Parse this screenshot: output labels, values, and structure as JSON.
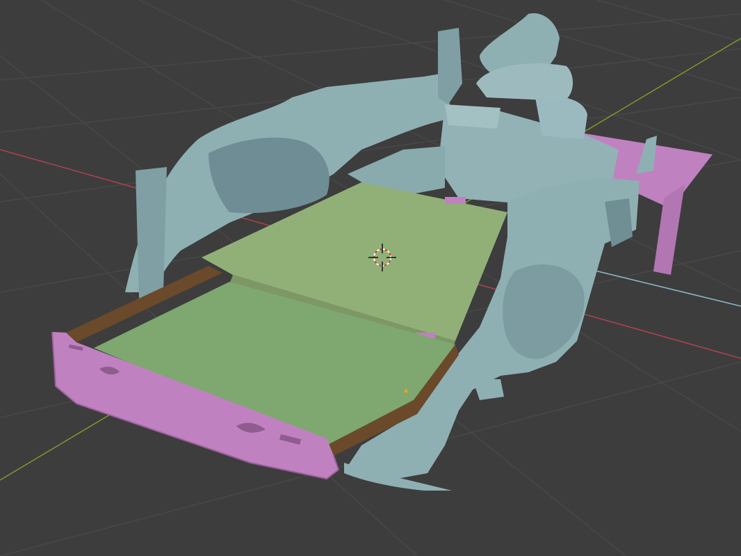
{
  "viewport": {
    "background": "#3d3d3d",
    "grid_color": "#484848",
    "x_axis_color": "#b04350",
    "y_axis_color": "#7d9a2e",
    "z_axis_color": "#8fb7c7"
  },
  "materials": {
    "scan_mesh": "#8fb0b3",
    "scan_shadow": "#5f7f86",
    "panel_pink": "#c081c0",
    "panel_pink_dark": "#9a5f9a",
    "board_green": "#7ea86f",
    "board_top": "#91b078",
    "drawer_wood": "#6a4a2a"
  },
  "selection": {
    "origin_marker": "3d-cursor"
  }
}
